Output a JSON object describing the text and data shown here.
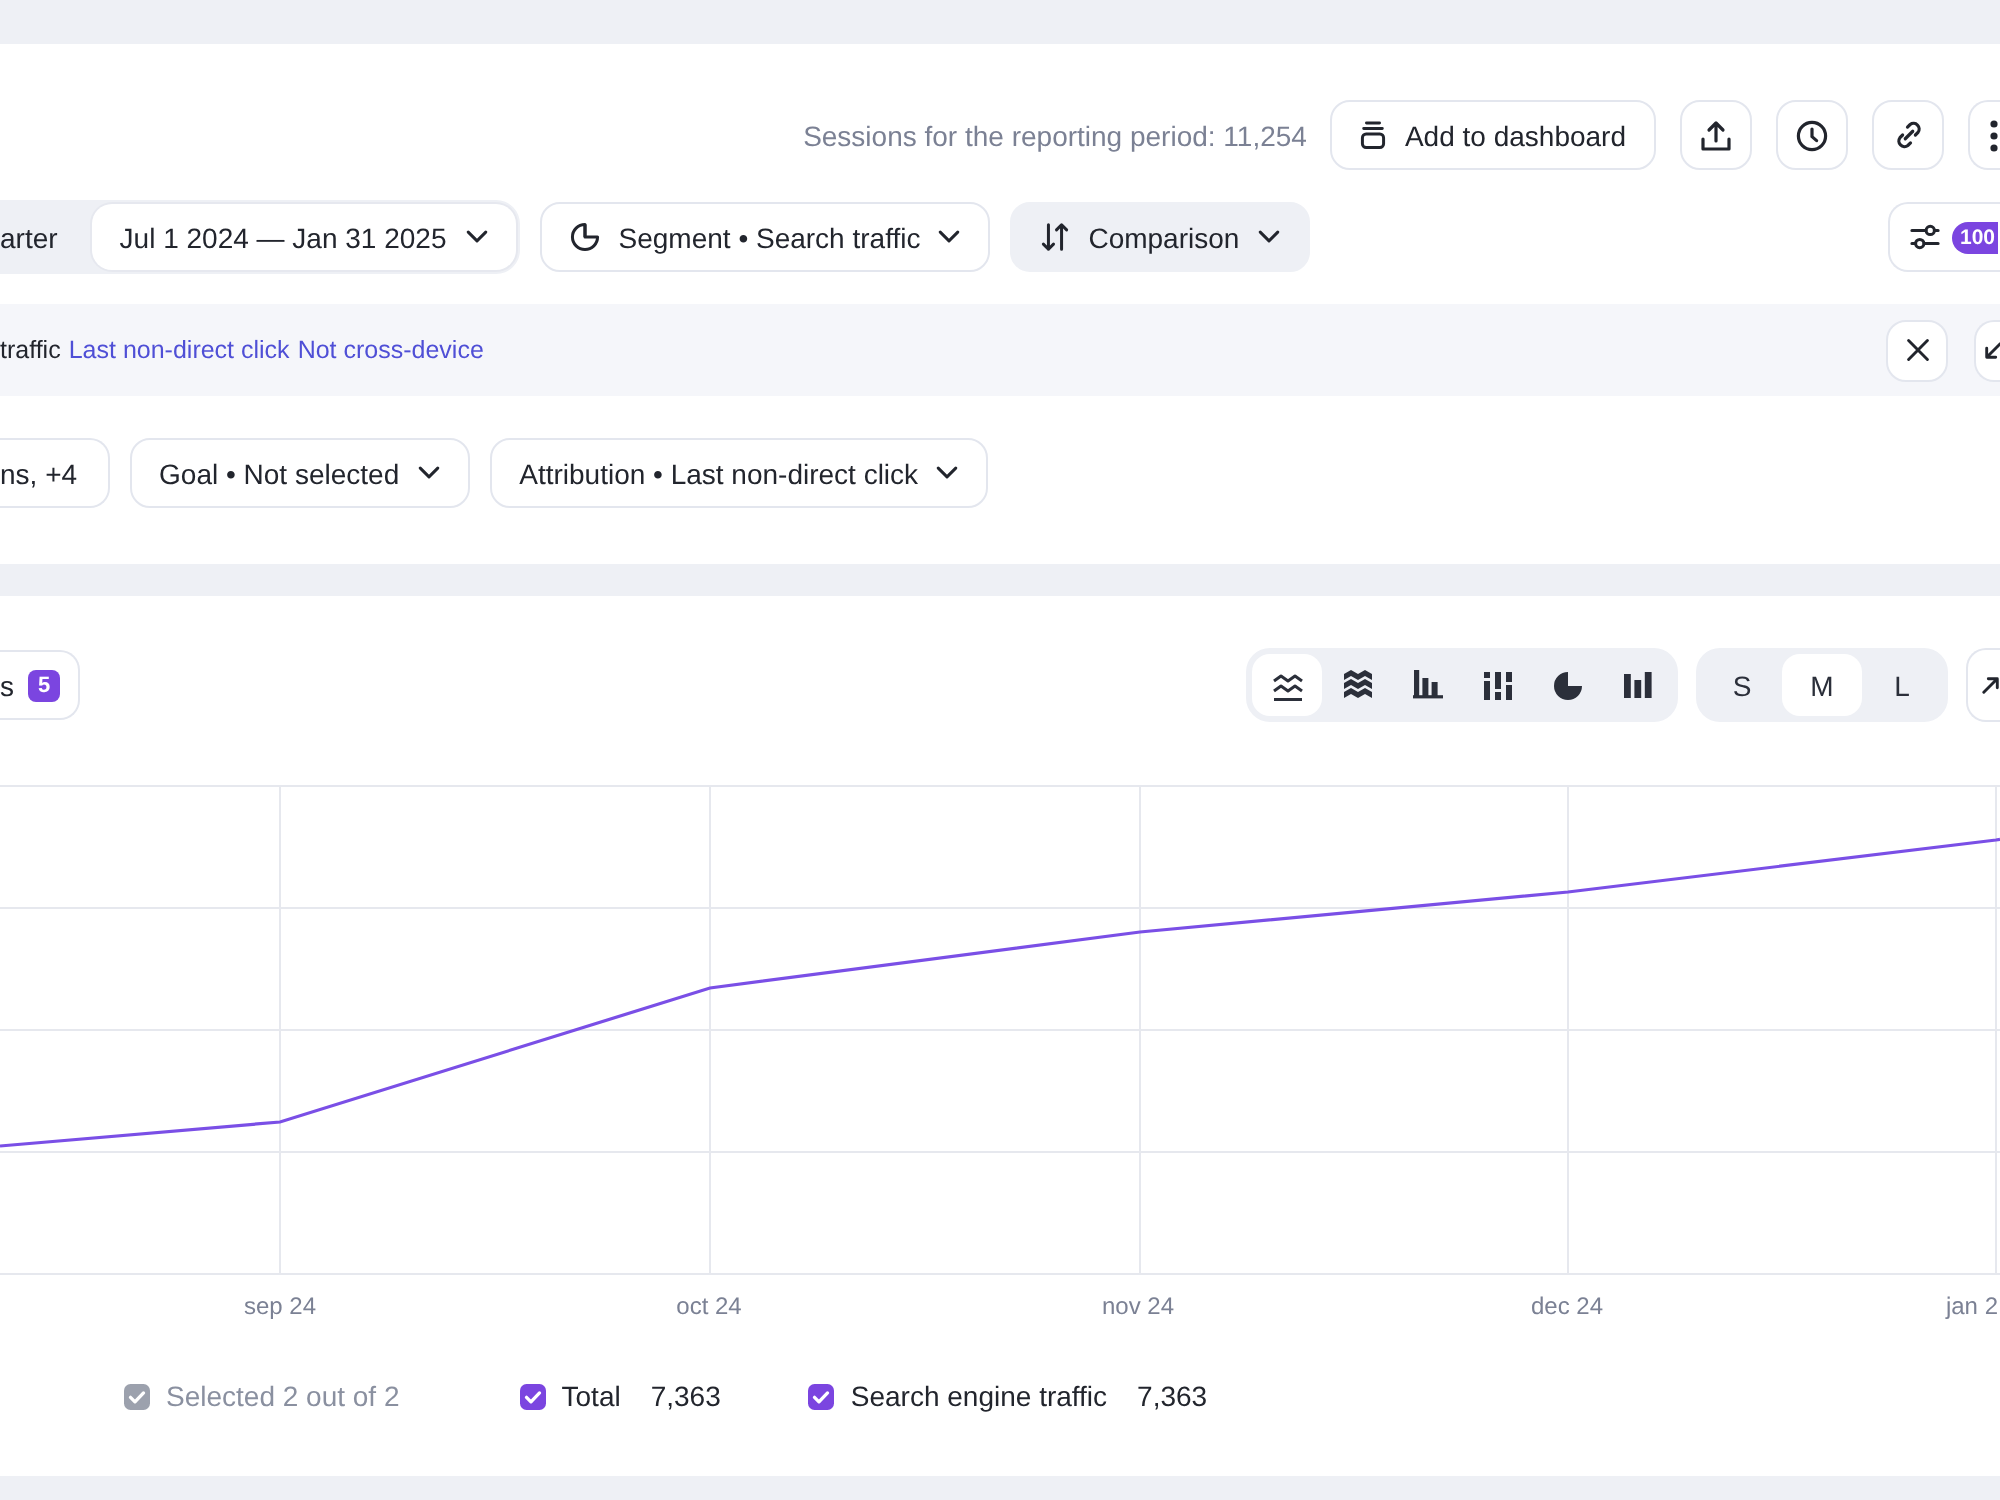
{
  "header": {
    "sessions": "Sessions for the reporting period: 11,254",
    "add_button": "Add to dashboard",
    "actions": [
      {
        "kind": "share"
      },
      {
        "kind": "history"
      },
      {
        "kind": "link"
      },
      {
        "kind": "more"
      }
    ]
  },
  "period": [
    {
      "label": "arter",
      "selected": false,
      "has_menu": false
    },
    {
      "label": "Jul 1 2024 — Jan 31 2025",
      "selected": true,
      "has_menu": true
    }
  ],
  "segment_button": "Segment • Search traffic",
  "comparison_button": "Comparison",
  "settings_badge": "100",
  "info_bar": {
    "text": "traffic",
    "links": [
      "Last non-direct click",
      "Not cross-device"
    ]
  },
  "filters": [
    {
      "label": "ns, +4",
      "has_menu": false
    },
    {
      "label": "Goal • Not selected",
      "has_menu": true
    },
    {
      "label": "Attribution • Last non-direct click",
      "has_menu": true
    }
  ],
  "chart_panel": {
    "groupings_button": {
      "label": "s",
      "count": "5"
    },
    "chart_types": [
      {
        "kind": "line",
        "selected": true
      },
      {
        "kind": "area",
        "selected": false
      },
      {
        "kind": "bar",
        "selected": false
      },
      {
        "kind": "stacked",
        "selected": false
      },
      {
        "kind": "pie",
        "selected": false
      },
      {
        "kind": "column",
        "selected": false
      }
    ],
    "sizes": [
      {
        "label": "S",
        "selected": false
      },
      {
        "label": "M",
        "selected": true
      },
      {
        "label": "L",
        "selected": false
      }
    ],
    "x_labels": [
      "sep 24",
      "oct 24",
      "nov 24",
      "dec 24",
      "jan 2"
    ],
    "legend": [
      {
        "kind": "all",
        "label": "Selected 2 out of 2",
        "checked": true
      },
      {
        "kind": "series",
        "label": "Total",
        "value": "7,363",
        "checked": true
      },
      {
        "kind": "series",
        "label": "Search engine traffic",
        "value": "7,363",
        "checked": true
      }
    ]
  }
}
